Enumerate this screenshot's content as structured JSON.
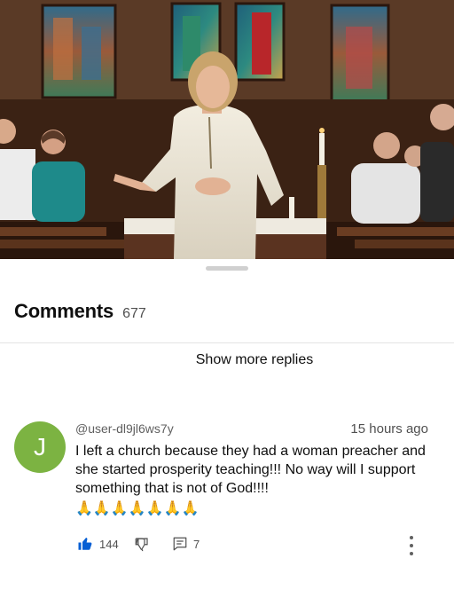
{
  "comments_panel": {
    "title": "Comments",
    "count": "677",
    "show_more_replies_label": "Show more replies"
  },
  "comment": {
    "avatar_letter": "J",
    "avatar_color": "#7cb342",
    "author": "@user-dl9jl6ws7y",
    "timestamp": "15 hours ago",
    "text": "I left a church because they had a woman preacher and she started prosperity teaching!!! No way will I support something that is not of God!!!!",
    "emoji": "🙏🙏🙏🙏🙏🙏🙏",
    "like_count": "144",
    "reply_count": "7"
  },
  "icons": {
    "like": "thumbs-up-icon",
    "dislike": "thumbs-down-icon",
    "reply": "reply-icon",
    "menu": "more-vertical-icon"
  },
  "colors": {
    "like_active": "#065fd4",
    "text_primary": "#0f0f0f",
    "text_secondary": "#606060"
  }
}
